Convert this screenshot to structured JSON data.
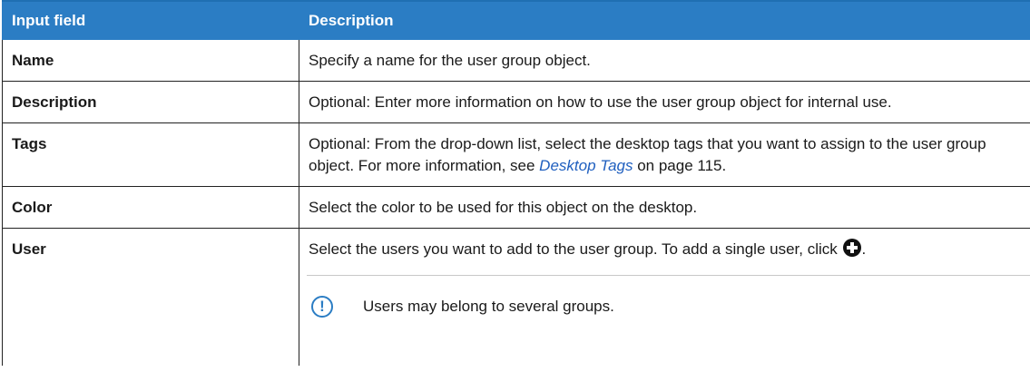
{
  "header": {
    "col1": "Input field",
    "col2": "Description"
  },
  "rows": [
    {
      "field": "Name",
      "description": "Specify a name for the user group object."
    },
    {
      "field": "Description",
      "description": "Optional: Enter more information on how to use the user group object for internal use."
    },
    {
      "field": "Tags",
      "description_before": "Optional: From the drop-down list, select the desktop tags that you want to assign to the user group object. For more information, see ",
      "link_text": "Desktop Tags",
      "description_after": " on page 115."
    },
    {
      "field": "Color",
      "description": "Select the color to be used for this object on the desktop."
    },
    {
      "field": "User",
      "description": "Select the users you want to add to the user group. To add a single user, click ",
      "description_end": ".",
      "icon": "plus-circle-icon"
    }
  ],
  "note": {
    "icon": "info-icon",
    "icon_glyph": "!",
    "text": "Users may belong to several groups."
  },
  "colors": {
    "header_bg": "#2b7dc4",
    "link": "#1f5fbf",
    "note_icon": "#2b7dc4"
  }
}
